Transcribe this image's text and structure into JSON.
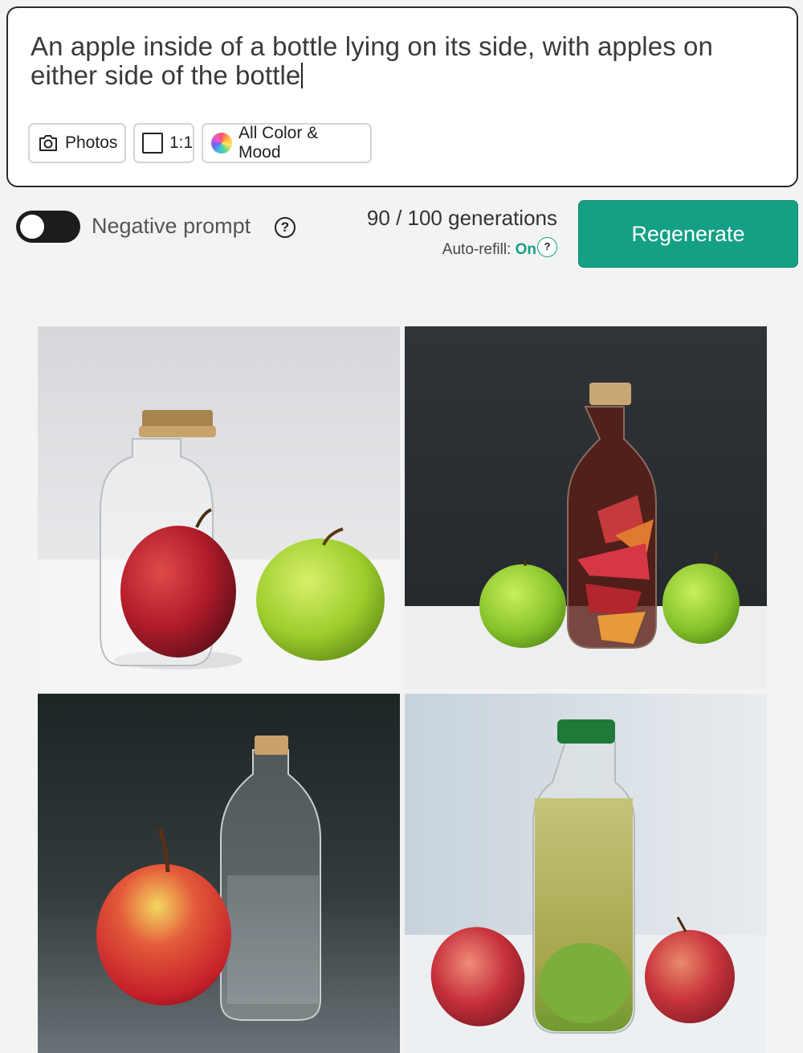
{
  "prompt": {
    "text": "An apple inside of a bottle lying on its side, with apples on either side of the bottle",
    "chips": {
      "photos": "Photos",
      "ratio": "1:1",
      "color_mood": "All Color & Mood"
    }
  },
  "controls": {
    "negative_prompt_label": "Negative prompt",
    "negative_prompt_enabled": false,
    "generations": "90 / 100 generations",
    "auto_refill_label": "Auto-refill:",
    "auto_refill_value": "On",
    "help_symbol": "?",
    "regenerate_label": "Regenerate"
  },
  "colors": {
    "accent": "#14a085",
    "toggle_off": "#1c1c1c"
  },
  "results": [
    {
      "icon": "generated-image",
      "scene": "clear-bottle-red-apple-green-apple"
    },
    {
      "icon": "generated-image",
      "scene": "amber-bottle-apple-slices-two-green-apples"
    },
    {
      "icon": "generated-image",
      "scene": "red-apple-beside-clear-bottle"
    },
    {
      "icon": "generated-image",
      "scene": "green-capped-bottle-two-red-apples"
    }
  ]
}
